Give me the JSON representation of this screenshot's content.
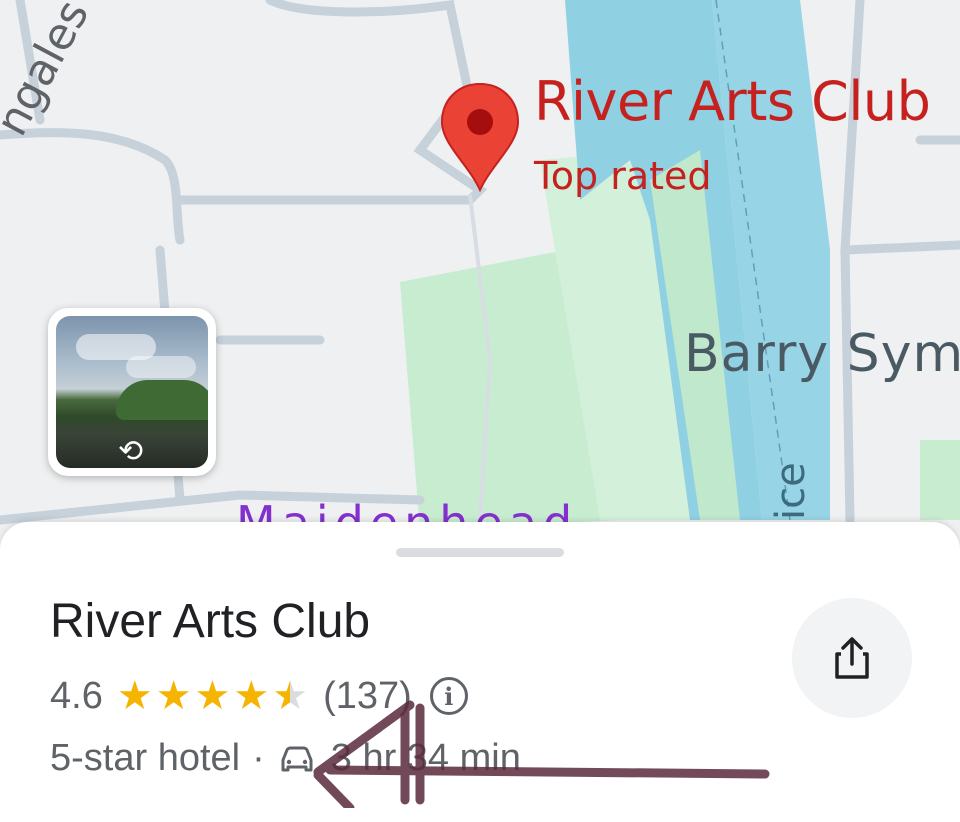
{
  "map": {
    "place_marker": {
      "name": "River Arts Club",
      "tag": "Top rated",
      "pin_color": "#ea4335"
    },
    "labels": {
      "road": "ngales",
      "park": "Barry Sym",
      "town": "Maidenhead",
      "river": "ice"
    },
    "colors": {
      "water": "#8fd0e3",
      "park": "#c8ecd0",
      "road": "#c6d1da",
      "land": "#eef0f1"
    },
    "street_view": {
      "rotate_icon": "360-rotate-icon"
    }
  },
  "sheet": {
    "title": "River Arts Club",
    "rating": {
      "value": "4.6",
      "stars": 4.5,
      "count": "(137)",
      "info_icon": "info-icon"
    },
    "meta": {
      "category": "5-star hotel",
      "separator": "·",
      "travel_icon": "car-icon",
      "travel_time": "3 hr 34 min"
    },
    "share_icon": "share-icon",
    "colors": {
      "star": "#f4b400",
      "text_secondary": "#5f6368",
      "title": "#202124"
    }
  },
  "annotation": {
    "arrow_color": "#5a2a3c"
  }
}
